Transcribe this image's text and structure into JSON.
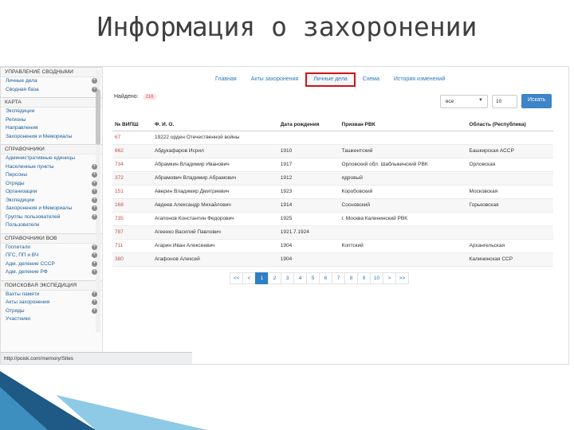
{
  "slide_title": "Информация о захоронении",
  "sidebar": {
    "sections": [
      {
        "label": "УПРАВЛЕНИЕ СВОДНЫМИ",
        "items": [
          {
            "label": "Личные дела",
            "plus": true
          },
          {
            "label": "Сводная база",
            "plus": true
          }
        ]
      },
      {
        "label": "КАРТА",
        "items": [
          {
            "label": "Экспедиции",
            "plus": false
          },
          {
            "label": "Регионы",
            "plus": false
          },
          {
            "label": "Направления",
            "plus": false
          },
          {
            "label": "Захоронения и Мемориалы",
            "plus": false
          }
        ]
      },
      {
        "label": "СПРАВОЧНИКИ",
        "items": [
          {
            "label": "Административные единицы",
            "plus": false
          },
          {
            "label": "Населенные пункты",
            "plus": true
          },
          {
            "label": "Персоны",
            "plus": true
          },
          {
            "label": "Отряды",
            "plus": true
          },
          {
            "label": "Организации",
            "plus": true
          },
          {
            "label": "Экспедиции",
            "plus": true
          },
          {
            "label": "Захоронения и Мемориалы",
            "plus": true
          },
          {
            "label": "Группы пользователей",
            "plus": true
          },
          {
            "label": "Пользователи",
            "plus": false
          }
        ]
      },
      {
        "label": "СПРАВОЧНИКИ ВОВ",
        "items": [
          {
            "label": "Госпитали",
            "plus": true
          },
          {
            "label": "ПГС, ПП и ВЧ",
            "plus": true
          },
          {
            "label": "Адм. деление СССР",
            "plus": true
          },
          {
            "label": "Адм. деление РФ",
            "plus": true
          }
        ]
      },
      {
        "label": "ПОИСКОВАЯ ЭКСПЕДИЦИЯ",
        "items": [
          {
            "label": "Вахты памяти",
            "plus": true
          },
          {
            "label": "Акты захоронения",
            "plus": true
          },
          {
            "label": "Отряды",
            "plus": true
          },
          {
            "label": "Участники",
            "plus": false
          }
        ]
      }
    ],
    "status_url": "http://poisk.com/memory/Sites"
  },
  "tabs": [
    {
      "label": "Главная",
      "active": false
    },
    {
      "label": "Акты захоронения",
      "active": false
    },
    {
      "label": "Личные дела",
      "active": true
    },
    {
      "label": "Схема",
      "active": false
    },
    {
      "label": "История изменений",
      "active": false
    }
  ],
  "found": {
    "label": "Найдено:",
    "count": "216"
  },
  "filter": {
    "select_value": "все",
    "per_page": "10",
    "show_label": "Искать"
  },
  "table": {
    "headers": [
      "№ ВИПШ",
      "Ф. И. О.",
      "Дата рождения",
      "Призван РВК",
      "Область (Республика)"
    ],
    "rows": [
      [
        "67",
        "19222 орден Отечественной войны",
        "",
        "",
        ""
      ],
      [
        "662",
        "Абдукафаров Исрил",
        "1910",
        "Ташкентский",
        "Башкирская АССР"
      ],
      [
        "734",
        "Абрамкин Владимир Иванович",
        "1917",
        "Орловский обл. Шаблыкинский РВК",
        "Орловская"
      ],
      [
        "372",
        "Абрамович Владимир Абрамович",
        "1912",
        "ядровый",
        ""
      ],
      [
        "151",
        "Аверин Владимир Дмитриевич",
        "1923",
        "Коробовский",
        "Московская"
      ],
      [
        "168",
        "Авдеев Александр Михайлович",
        "1914",
        "Сосновский",
        "Горьковская"
      ],
      [
        "735",
        "Агапонов Константин Федорович",
        "1925",
        "г. Москва Калининский РВК",
        ""
      ],
      [
        "787",
        "Агеенко Василий Павлович",
        "1921.7.1924",
        "",
        ""
      ],
      [
        "711",
        "Агарин Иван Алексеевич",
        "1904",
        "Коптский",
        "Архангельская"
      ],
      [
        "380",
        "Агафонов Алексей",
        "1904",
        "",
        "Калининская ССР"
      ]
    ]
  },
  "pager": [
    "<<",
    "<",
    "1",
    "2",
    "3",
    "4",
    "5",
    "6",
    "7",
    "8",
    "9",
    "10",
    ">",
    ">>"
  ],
  "pager_active": "1",
  "colors": {
    "accent": "#2f7fc3",
    "highlight": "#d0121a",
    "corner_dark": "#1f5a86",
    "corner_light": "#8ec9e6"
  }
}
